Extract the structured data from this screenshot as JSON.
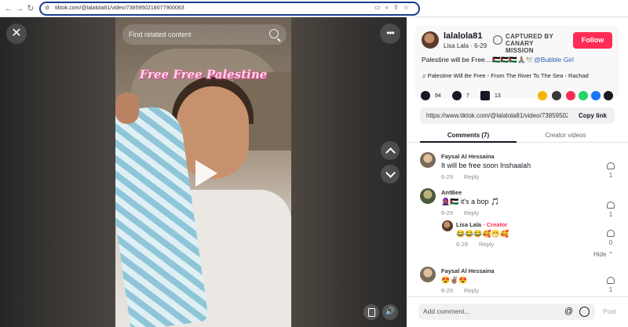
{
  "browser": {
    "url": "tiktok.com/@lalalola81/video/7385950218077900063"
  },
  "player": {
    "search_placeholder": "Find related content",
    "overlay_title": "Free Free Palestine",
    "close_icon": "✕",
    "more_icon": "•••",
    "volume_icon": "🔊"
  },
  "author": {
    "username": "lalalola81",
    "nickname_date": "Lisa Lala · 6-29",
    "canary_line1": "CAPTURED BY",
    "canary_line2": "CANARY MISSION",
    "follow_label": "Follow"
  },
  "post": {
    "desc_text": "Palestine will be Free....🇵🇸🇵🇸🇵🇸🙏🏽🕊️",
    "mention": "@Bubble Girl",
    "music": "♫  Palestine Will Be Free - From The River To The Sea - Rachad"
  },
  "stats": {
    "likes": "94",
    "comments": "7",
    "saves": "13"
  },
  "share_colors": [
    "#f7b500",
    "#3a3a3a",
    "#fe2c55",
    "#25d366",
    "#1877f2",
    "#161823"
  ],
  "link": {
    "url": "https://www.tiktok.com/@lalalola81/video/738595021...",
    "copy_label": "Copy link"
  },
  "tabs": {
    "comments": "Comments (7)",
    "creator_videos": "Creator videos"
  },
  "comments": [
    {
      "name": "Faysal Al Hessaina",
      "text": "It will be free soon Inshaalah",
      "date": "6-29",
      "reply": "Reply",
      "likes": "1"
    },
    {
      "name": "AntBee",
      "text": "🧕🏾🇵🇸 it's a bop 🎵",
      "date": "6-29",
      "reply": "Reply",
      "likes": "1"
    },
    {
      "name": "Lisa Lala",
      "creator_tag": " · Creator",
      "text": "😂😂😂🥰😁🥰",
      "date": "6-29",
      "reply": "Reply",
      "likes": "0"
    },
    {
      "name": "Faysal Al Hessaina",
      "text": "😍✌🏽😍",
      "date": "6-29",
      "reply": "Reply",
      "likes": "1"
    }
  ],
  "hide_label": "Hide ⌃",
  "composer": {
    "placeholder": "Add comment...",
    "at": "@",
    "post_label": "Post"
  }
}
